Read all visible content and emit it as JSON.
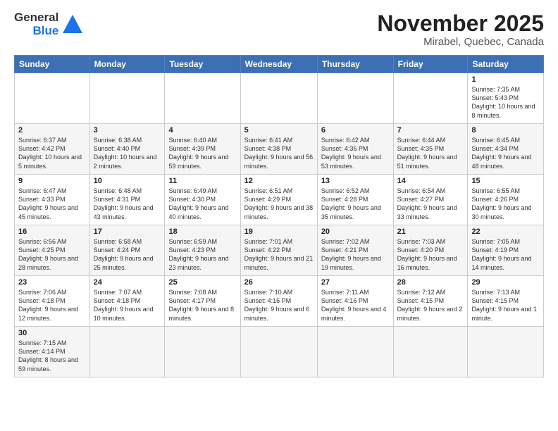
{
  "logo": {
    "text_general": "General",
    "text_blue": "Blue"
  },
  "title": "November 2025",
  "location": "Mirabel, Quebec, Canada",
  "days_of_week": [
    "Sunday",
    "Monday",
    "Tuesday",
    "Wednesday",
    "Thursday",
    "Friday",
    "Saturday"
  ],
  "weeks": [
    [
      {
        "day": "",
        "info": ""
      },
      {
        "day": "",
        "info": ""
      },
      {
        "day": "",
        "info": ""
      },
      {
        "day": "",
        "info": ""
      },
      {
        "day": "",
        "info": ""
      },
      {
        "day": "",
        "info": ""
      },
      {
        "day": "1",
        "info": "Sunrise: 7:35 AM\nSunset: 5:43 PM\nDaylight: 10 hours and 8 minutes."
      }
    ],
    [
      {
        "day": "2",
        "info": "Sunrise: 6:37 AM\nSunset: 4:42 PM\nDaylight: 10 hours and 5 minutes."
      },
      {
        "day": "3",
        "info": "Sunrise: 6:38 AM\nSunset: 4:40 PM\nDaylight: 10 hours and 2 minutes."
      },
      {
        "day": "4",
        "info": "Sunrise: 6:40 AM\nSunset: 4:39 PM\nDaylight: 9 hours and 59 minutes."
      },
      {
        "day": "5",
        "info": "Sunrise: 6:41 AM\nSunset: 4:38 PM\nDaylight: 9 hours and 56 minutes."
      },
      {
        "day": "6",
        "info": "Sunrise: 6:42 AM\nSunset: 4:36 PM\nDaylight: 9 hours and 53 minutes."
      },
      {
        "day": "7",
        "info": "Sunrise: 6:44 AM\nSunset: 4:35 PM\nDaylight: 9 hours and 51 minutes."
      },
      {
        "day": "8",
        "info": "Sunrise: 6:45 AM\nSunset: 4:34 PM\nDaylight: 9 hours and 48 minutes."
      }
    ],
    [
      {
        "day": "9",
        "info": "Sunrise: 6:47 AM\nSunset: 4:33 PM\nDaylight: 9 hours and 45 minutes."
      },
      {
        "day": "10",
        "info": "Sunrise: 6:48 AM\nSunset: 4:31 PM\nDaylight: 9 hours and 43 minutes."
      },
      {
        "day": "11",
        "info": "Sunrise: 6:49 AM\nSunset: 4:30 PM\nDaylight: 9 hours and 40 minutes."
      },
      {
        "day": "12",
        "info": "Sunrise: 6:51 AM\nSunset: 4:29 PM\nDaylight: 9 hours and 38 minutes."
      },
      {
        "day": "13",
        "info": "Sunrise: 6:52 AM\nSunset: 4:28 PM\nDaylight: 9 hours and 35 minutes."
      },
      {
        "day": "14",
        "info": "Sunrise: 6:54 AM\nSunset: 4:27 PM\nDaylight: 9 hours and 33 minutes."
      },
      {
        "day": "15",
        "info": "Sunrise: 6:55 AM\nSunset: 4:26 PM\nDaylight: 9 hours and 30 minutes."
      }
    ],
    [
      {
        "day": "16",
        "info": "Sunrise: 6:56 AM\nSunset: 4:25 PM\nDaylight: 9 hours and 28 minutes."
      },
      {
        "day": "17",
        "info": "Sunrise: 6:58 AM\nSunset: 4:24 PM\nDaylight: 9 hours and 25 minutes."
      },
      {
        "day": "18",
        "info": "Sunrise: 6:59 AM\nSunset: 4:23 PM\nDaylight: 9 hours and 23 minutes."
      },
      {
        "day": "19",
        "info": "Sunrise: 7:01 AM\nSunset: 4:22 PM\nDaylight: 9 hours and 21 minutes."
      },
      {
        "day": "20",
        "info": "Sunrise: 7:02 AM\nSunset: 4:21 PM\nDaylight: 9 hours and 19 minutes."
      },
      {
        "day": "21",
        "info": "Sunrise: 7:03 AM\nSunset: 4:20 PM\nDaylight: 9 hours and 16 minutes."
      },
      {
        "day": "22",
        "info": "Sunrise: 7:05 AM\nSunset: 4:19 PM\nDaylight: 9 hours and 14 minutes."
      }
    ],
    [
      {
        "day": "23",
        "info": "Sunrise: 7:06 AM\nSunset: 4:18 PM\nDaylight: 9 hours and 12 minutes."
      },
      {
        "day": "24",
        "info": "Sunrise: 7:07 AM\nSunset: 4:18 PM\nDaylight: 9 hours and 10 minutes."
      },
      {
        "day": "25",
        "info": "Sunrise: 7:08 AM\nSunset: 4:17 PM\nDaylight: 9 hours and 8 minutes."
      },
      {
        "day": "26",
        "info": "Sunrise: 7:10 AM\nSunset: 4:16 PM\nDaylight: 9 hours and 6 minutes."
      },
      {
        "day": "27",
        "info": "Sunrise: 7:11 AM\nSunset: 4:16 PM\nDaylight: 9 hours and 4 minutes."
      },
      {
        "day": "28",
        "info": "Sunrise: 7:12 AM\nSunset: 4:15 PM\nDaylight: 9 hours and 2 minutes."
      },
      {
        "day": "29",
        "info": "Sunrise: 7:13 AM\nSunset: 4:15 PM\nDaylight: 9 hours and 1 minute."
      }
    ],
    [
      {
        "day": "30",
        "info": "Sunrise: 7:15 AM\nSunset: 4:14 PM\nDaylight: 8 hours and 59 minutes."
      },
      {
        "day": "",
        "info": ""
      },
      {
        "day": "",
        "info": ""
      },
      {
        "day": "",
        "info": ""
      },
      {
        "day": "",
        "info": ""
      },
      {
        "day": "",
        "info": ""
      },
      {
        "day": "",
        "info": ""
      }
    ]
  ]
}
